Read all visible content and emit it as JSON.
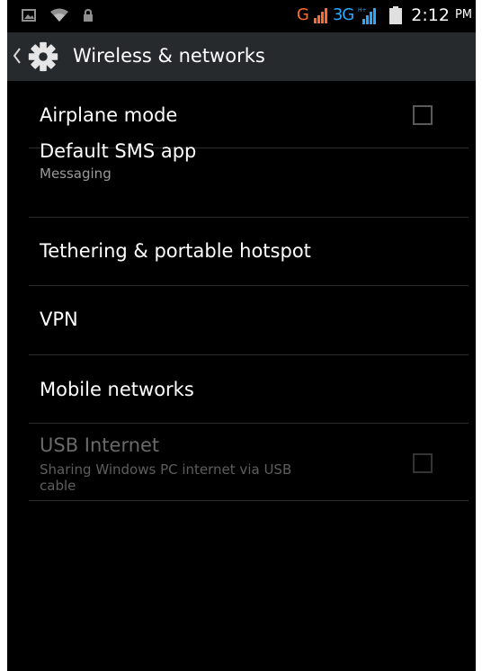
{
  "status_bar": {
    "left_icons": [
      "image-notification-icon",
      "wifi-icon",
      "lock-icon"
    ],
    "network_g": "G",
    "network_3g": "3G",
    "time": "2:12",
    "ampm": "PM",
    "colors": {
      "g": "#ff6a2a",
      "threeg": "#2aa8ff"
    }
  },
  "action_bar": {
    "title": "Wireless & networks",
    "icon": "settings-gear-icon"
  },
  "settings": {
    "airplane_mode": {
      "title": "Airplane mode",
      "checked": false
    },
    "default_sms": {
      "title": "Default SMS app",
      "summary": "Messaging"
    },
    "tethering": {
      "title": "Tethering & portable hotspot"
    },
    "vpn": {
      "title": "VPN"
    },
    "mobile_networks": {
      "title": "Mobile networks"
    },
    "usb_internet": {
      "title": "USB Internet",
      "summary_line1": "Sharing Windows PC internet via USB",
      "summary_line2": "cable",
      "checked": false,
      "enabled": false
    }
  }
}
